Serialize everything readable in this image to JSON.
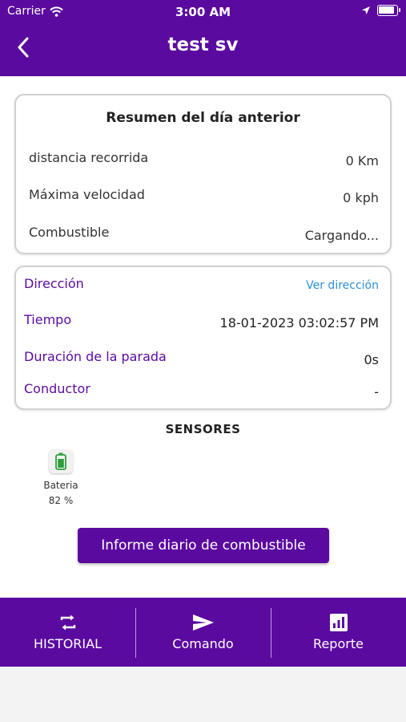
{
  "status_bar": {
    "carrier": "Carrier",
    "time": "3:00 AM",
    "battery_level": 0.95
  },
  "header": {
    "title": "test sv"
  },
  "summary": {
    "title": "Resumen del día anterior",
    "rows": [
      {
        "label": "distancia recorrida",
        "value": "0 Km"
      },
      {
        "label": "Máxima velocidad",
        "value": "0 kph"
      },
      {
        "label": "Combustible",
        "value": "Cargando..."
      }
    ]
  },
  "details": {
    "direction_label": "Dirección",
    "direction_link": "Ver dirección",
    "time_label": "Tiempo",
    "time_value": "18-01-2023 03:02:57 PM",
    "stop_label": "Duración de la parada",
    "stop_value": "0s",
    "driver_label": "Conductor",
    "driver_value": "-"
  },
  "sensors": {
    "title": "SENSORES",
    "items": [
      {
        "icon": "battery-icon",
        "name": "Bateria",
        "value": "82 %"
      }
    ]
  },
  "report_button": "Informe diario de combustible",
  "bottom_nav": {
    "items": [
      {
        "icon": "history-icon",
        "label": "HISTORIAL"
      },
      {
        "icon": "send-icon",
        "label": "Comando"
      },
      {
        "icon": "report-icon",
        "label": "Reporte"
      }
    ]
  },
  "colors": {
    "primary": "#5b0aa0",
    "link": "#2f8fd6",
    "battery_green": "#2e9e3e"
  }
}
